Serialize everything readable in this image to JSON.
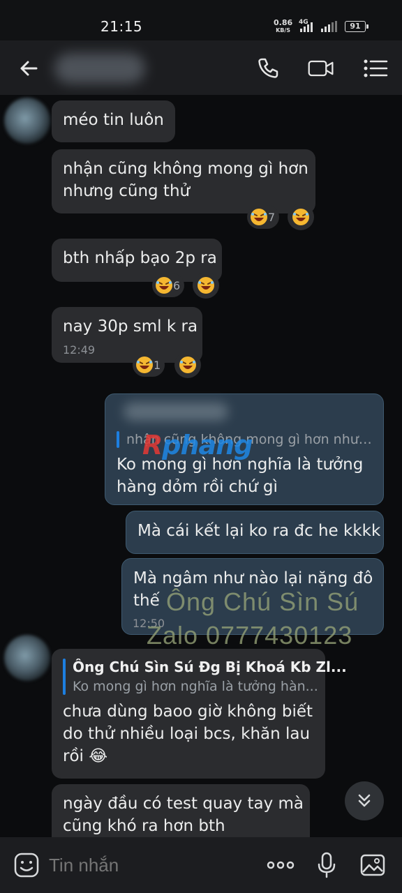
{
  "status_bar": {
    "time": "21:15",
    "net_speed": "0.86",
    "net_unit": "KB/S",
    "network_type": "4G",
    "battery": "91"
  },
  "header": {
    "contact_name": ""
  },
  "messages": [
    {
      "text": "méo tin luôn"
    },
    {
      "line1": "nhận cũng không mong gì hơn",
      "line2": "nhưng cũng thử",
      "reaction_count": "7"
    },
    {
      "text": "bth nhấp bạo 2p ra",
      "reaction_count": "6"
    },
    {
      "text": "nay 30p sml k ra",
      "time": "12:49",
      "reaction_count": "1"
    },
    {
      "quote_text": "nhận cũng không mong gì hơn nhưn...",
      "line1": "Ko mong gì hơn nghĩa là tưởng",
      "line2": "hàng dỏm rồi chứ gì"
    },
    {
      "text": "Mà cái kết lại ko ra đc he kkkk"
    },
    {
      "line1": "Mà ngâm như nào lại nặng đô",
      "line2": "thế",
      "time": "12:50"
    },
    {
      "quote_author": "Ông Chú Sìn Sú Đg Bị Khoá Kb Zl...",
      "quote_text": "Ko mong gì hơn nghĩa là tưởng hàn...",
      "line1": "chưa dùng baoo giờ không biết",
      "line2": "do thử nhiều loại bcs, khăn lau",
      "line3": "rồi 😂"
    },
    {
      "line1": "ngày đầu có test quay tay mà",
      "line2": "cũng khó ra hơn bth"
    }
  ],
  "watermarks": {
    "logo_part1": "R",
    "logo_part2": "phang",
    "line1": "Ông Chú Sìn Sú",
    "line2": "Zalo 0777430123"
  },
  "input": {
    "placeholder": "Tin nhắn"
  },
  "icons": {
    "back": "back-arrow-icon",
    "call": "phone-icon",
    "video": "video-camera-icon",
    "menu": "list-menu-icon",
    "sticker": "sticker-smile-icon",
    "more": "more-dots-icon",
    "mic": "microphone-icon",
    "image": "image-gallery-icon",
    "scroll": "chevron-double-down-icon",
    "reaction": "laughing-emoji-icon"
  },
  "colors": {
    "incoming_bubble": "#2b2c2f",
    "outgoing_bubble": "#2c3d4d",
    "quote_bar": "#1d7fe0",
    "background": "#0b0c0e"
  }
}
